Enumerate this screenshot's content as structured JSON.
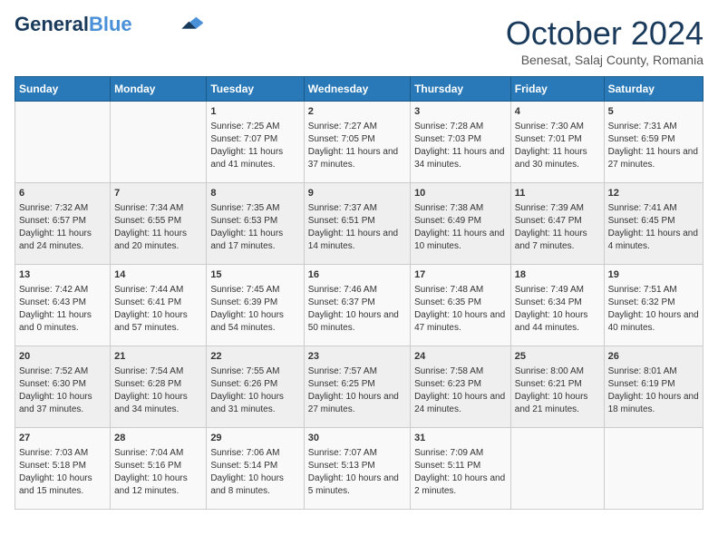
{
  "header": {
    "logo_line1": "General",
    "logo_line2": "Blue",
    "month_title": "October 2024",
    "location": "Benesat, Salaj County, Romania"
  },
  "days_of_week": [
    "Sunday",
    "Monday",
    "Tuesday",
    "Wednesday",
    "Thursday",
    "Friday",
    "Saturday"
  ],
  "weeks": [
    [
      {
        "day": "",
        "info": ""
      },
      {
        "day": "",
        "info": ""
      },
      {
        "day": "1",
        "info": "Sunrise: 7:25 AM\nSunset: 7:07 PM\nDaylight: 11 hours and 41 minutes."
      },
      {
        "day": "2",
        "info": "Sunrise: 7:27 AM\nSunset: 7:05 PM\nDaylight: 11 hours and 37 minutes."
      },
      {
        "day": "3",
        "info": "Sunrise: 7:28 AM\nSunset: 7:03 PM\nDaylight: 11 hours and 34 minutes."
      },
      {
        "day": "4",
        "info": "Sunrise: 7:30 AM\nSunset: 7:01 PM\nDaylight: 11 hours and 30 minutes."
      },
      {
        "day": "5",
        "info": "Sunrise: 7:31 AM\nSunset: 6:59 PM\nDaylight: 11 hours and 27 minutes."
      }
    ],
    [
      {
        "day": "6",
        "info": "Sunrise: 7:32 AM\nSunset: 6:57 PM\nDaylight: 11 hours and 24 minutes."
      },
      {
        "day": "7",
        "info": "Sunrise: 7:34 AM\nSunset: 6:55 PM\nDaylight: 11 hours and 20 minutes."
      },
      {
        "day": "8",
        "info": "Sunrise: 7:35 AM\nSunset: 6:53 PM\nDaylight: 11 hours and 17 minutes."
      },
      {
        "day": "9",
        "info": "Sunrise: 7:37 AM\nSunset: 6:51 PM\nDaylight: 11 hours and 14 minutes."
      },
      {
        "day": "10",
        "info": "Sunrise: 7:38 AM\nSunset: 6:49 PM\nDaylight: 11 hours and 10 minutes."
      },
      {
        "day": "11",
        "info": "Sunrise: 7:39 AM\nSunset: 6:47 PM\nDaylight: 11 hours and 7 minutes."
      },
      {
        "day": "12",
        "info": "Sunrise: 7:41 AM\nSunset: 6:45 PM\nDaylight: 11 hours and 4 minutes."
      }
    ],
    [
      {
        "day": "13",
        "info": "Sunrise: 7:42 AM\nSunset: 6:43 PM\nDaylight: 11 hours and 0 minutes."
      },
      {
        "day": "14",
        "info": "Sunrise: 7:44 AM\nSunset: 6:41 PM\nDaylight: 10 hours and 57 minutes."
      },
      {
        "day": "15",
        "info": "Sunrise: 7:45 AM\nSunset: 6:39 PM\nDaylight: 10 hours and 54 minutes."
      },
      {
        "day": "16",
        "info": "Sunrise: 7:46 AM\nSunset: 6:37 PM\nDaylight: 10 hours and 50 minutes."
      },
      {
        "day": "17",
        "info": "Sunrise: 7:48 AM\nSunset: 6:35 PM\nDaylight: 10 hours and 47 minutes."
      },
      {
        "day": "18",
        "info": "Sunrise: 7:49 AM\nSunset: 6:34 PM\nDaylight: 10 hours and 44 minutes."
      },
      {
        "day": "19",
        "info": "Sunrise: 7:51 AM\nSunset: 6:32 PM\nDaylight: 10 hours and 40 minutes."
      }
    ],
    [
      {
        "day": "20",
        "info": "Sunrise: 7:52 AM\nSunset: 6:30 PM\nDaylight: 10 hours and 37 minutes."
      },
      {
        "day": "21",
        "info": "Sunrise: 7:54 AM\nSunset: 6:28 PM\nDaylight: 10 hours and 34 minutes."
      },
      {
        "day": "22",
        "info": "Sunrise: 7:55 AM\nSunset: 6:26 PM\nDaylight: 10 hours and 31 minutes."
      },
      {
        "day": "23",
        "info": "Sunrise: 7:57 AM\nSunset: 6:25 PM\nDaylight: 10 hours and 27 minutes."
      },
      {
        "day": "24",
        "info": "Sunrise: 7:58 AM\nSunset: 6:23 PM\nDaylight: 10 hours and 24 minutes."
      },
      {
        "day": "25",
        "info": "Sunrise: 8:00 AM\nSunset: 6:21 PM\nDaylight: 10 hours and 21 minutes."
      },
      {
        "day": "26",
        "info": "Sunrise: 8:01 AM\nSunset: 6:19 PM\nDaylight: 10 hours and 18 minutes."
      }
    ],
    [
      {
        "day": "27",
        "info": "Sunrise: 7:03 AM\nSunset: 5:18 PM\nDaylight: 10 hours and 15 minutes."
      },
      {
        "day": "28",
        "info": "Sunrise: 7:04 AM\nSunset: 5:16 PM\nDaylight: 10 hours and 12 minutes."
      },
      {
        "day": "29",
        "info": "Sunrise: 7:06 AM\nSunset: 5:14 PM\nDaylight: 10 hours and 8 minutes."
      },
      {
        "day": "30",
        "info": "Sunrise: 7:07 AM\nSunset: 5:13 PM\nDaylight: 10 hours and 5 minutes."
      },
      {
        "day": "31",
        "info": "Sunrise: 7:09 AM\nSunset: 5:11 PM\nDaylight: 10 hours and 2 minutes."
      },
      {
        "day": "",
        "info": ""
      },
      {
        "day": "",
        "info": ""
      }
    ]
  ]
}
